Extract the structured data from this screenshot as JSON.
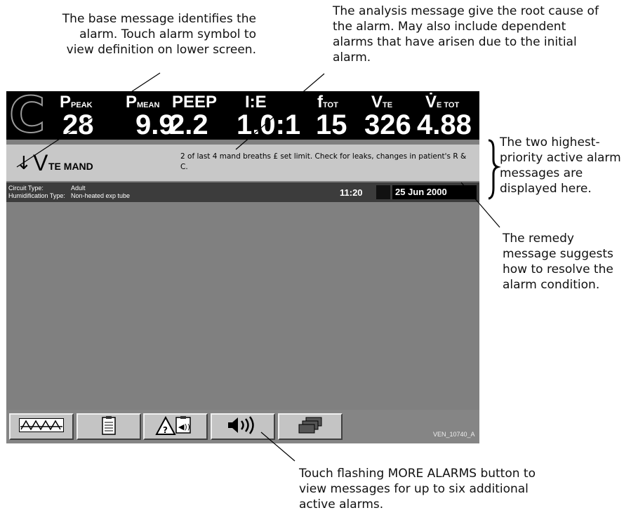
{
  "callouts": {
    "base": "The base message identifies the alarm. Touch alarm symbol to view definition on lower screen.",
    "analysis": "The analysis message give the root cause of the alarm. May also include dependent alarms that have arisen due to the initial alarm.",
    "priority": "The two highest-priority active alarm messages are displayed here.",
    "remedy": "The remedy message suggests how to resolve the alarm condition.",
    "more_alarms": "Touch flashing MORE ALARMS button to view messages for up to six additional active alarms."
  },
  "header": {
    "mode_letter": "C",
    "params": [
      {
        "label": "P",
        "sub": "PEAK",
        "value": "28"
      },
      {
        "label": "P",
        "sub": "MEAN",
        "value": "9.9"
      },
      {
        "label": "PEEP",
        "sub": "",
        "value": "2.2"
      },
      {
        "label": "I:E",
        "sub": "",
        "value": "1.0:1"
      },
      {
        "label": "f",
        "sub": "TOT",
        "value": "15"
      },
      {
        "label": "V",
        "sub": "TE",
        "value": "326"
      },
      {
        "label": "V̇",
        "sub": "E TOT",
        "value": "4.88"
      }
    ]
  },
  "alarm": {
    "arrow": "↓",
    "symbol": "V",
    "symbol_sub": "TE MAND",
    "analysis_remedy": "2 of last 4 mand breaths £ set limit. Check for leaks, changes in patient's R & C."
  },
  "status": {
    "circuit_type_label": "Circuit Type:",
    "circuit_type_value": "Adult",
    "humidification_label": "Humidification Type:",
    "humidification_value": "Non-heated exp tube",
    "time": "11:20",
    "date": "25 Jun 2000"
  },
  "buttons": [
    {
      "icon": "waveform-icon"
    },
    {
      "icon": "clipboard-icon"
    },
    {
      "icon": "alarm-log-icon"
    },
    {
      "icon": "speaker-icon"
    },
    {
      "icon": "more-screens-icon"
    }
  ],
  "figure_id": "VEN_10740_A",
  "colors": {
    "header_bg": "#000000",
    "alarm_bar_bg": "#c8c8c8",
    "screen_bg": "#808080",
    "status_bg": "#3c3c3c"
  }
}
